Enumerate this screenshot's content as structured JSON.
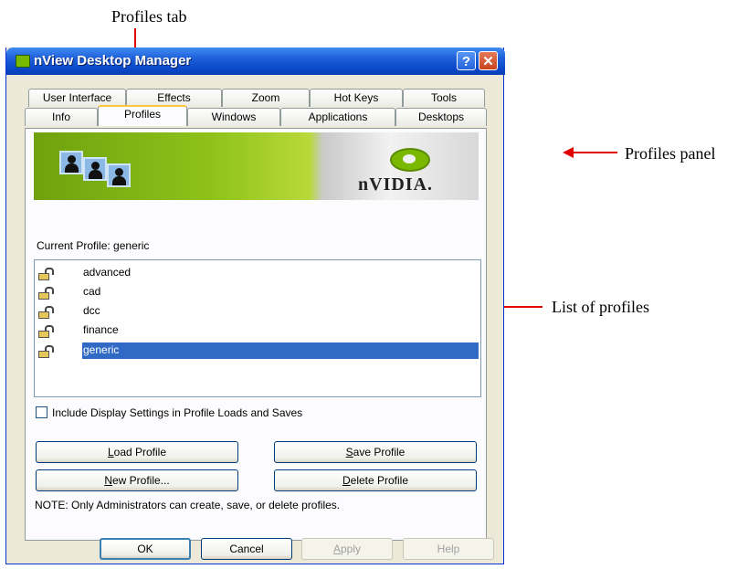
{
  "annotations": {
    "profiles_tab": "Profiles tab",
    "profiles_panel": "Profiles panel",
    "list_of_profiles": "List of profiles"
  },
  "colors": {
    "arrow": "#e00000",
    "titlebar": "#0a46c8",
    "selection": "#316ac5",
    "nvidia_green": "#76b900"
  },
  "window": {
    "title": "nView Desktop Manager",
    "help_button": "?",
    "close_button": "✕"
  },
  "tabs": {
    "row_back": [
      "User Interface",
      "Effects",
      "Zoom",
      "Hot Keys",
      "Tools"
    ],
    "row_front": [
      "Info",
      "Profiles",
      "Windows",
      "Applications",
      "Desktops"
    ],
    "active": "Profiles"
  },
  "banner": {
    "brand": "nVIDIA."
  },
  "current_profile": {
    "label": "Current Profile:",
    "value": "generic"
  },
  "profiles": [
    {
      "name": "advanced",
      "selected": false
    },
    {
      "name": "cad",
      "selected": false
    },
    {
      "name": "dcc",
      "selected": false
    },
    {
      "name": "finance",
      "selected": false
    },
    {
      "name": "generic",
      "selected": true
    }
  ],
  "include_display_settings": {
    "label": "Include Display Settings in Profile Loads and Saves",
    "checked": false
  },
  "buttons": {
    "load": {
      "underlined": "L",
      "rest": "oad Profile"
    },
    "save": {
      "underlined": "S",
      "rest": "ave Profile"
    },
    "new": {
      "underlined": "N",
      "rest": "ew Profile..."
    },
    "delete": {
      "underlined": "D",
      "rest": "elete Profile"
    }
  },
  "note": "NOTE: Only Administrators can create, save, or delete profiles.",
  "dialog_buttons": {
    "ok": "OK",
    "cancel": "Cancel",
    "apply": {
      "underlined": "A",
      "rest": "pply"
    },
    "help": "Help"
  }
}
